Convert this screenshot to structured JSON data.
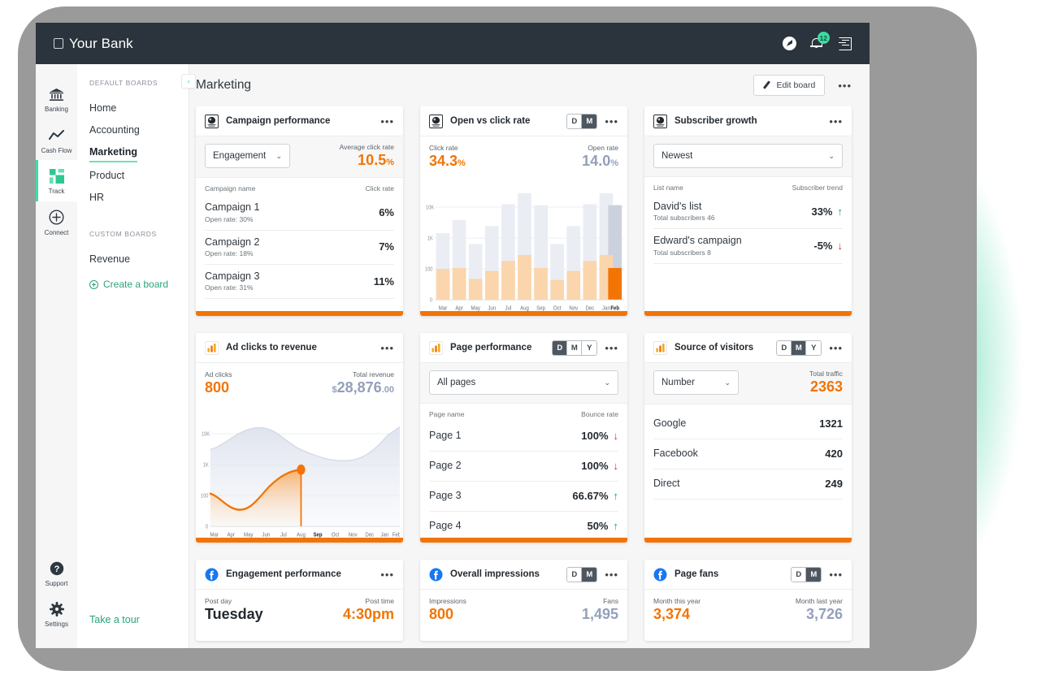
{
  "brand": {
    "name": "Your Bank"
  },
  "topbar": {
    "icons": [
      "compass-icon",
      "bell-icon",
      "logout-icon"
    ],
    "notification_count": "12"
  },
  "rail": {
    "items": [
      {
        "label": "Banking",
        "icon": "bank-icon",
        "active": false
      },
      {
        "label": "Cash Flow",
        "icon": "trend-line-icon",
        "active": false
      },
      {
        "label": "Track",
        "icon": "grid-squares-icon",
        "active": true
      },
      {
        "label": "Connect",
        "icon": "plus-circle-icon",
        "active": false
      }
    ],
    "bottom": [
      {
        "label": "Support",
        "icon": "help-circle-icon"
      },
      {
        "label": "Settings",
        "icon": "gear-icon"
      }
    ]
  },
  "boards": {
    "default_title": "DEFAULT BOARDS",
    "default_items": [
      "Home",
      "Accounting",
      "Marketing",
      "Product",
      "HR"
    ],
    "active_item": "Marketing",
    "custom_title": "CUSTOM BOARDS",
    "custom_items": [
      "Revenue"
    ],
    "create_label": "Create a board",
    "take_tour_label": "Take a tour",
    "collapse_icon": "chevron-left-icon"
  },
  "header": {
    "title": "Marketing",
    "edit_label": "Edit board",
    "more_icon": "ellipsis-icon"
  },
  "accent_color": "#f27405",
  "blue_color": "#93a0bb",
  "green_color": "#3ddca4",
  "cards": {
    "campaign_performance": {
      "title": "Campaign performance",
      "icon": "mailchimp-icon",
      "select": "Engagement",
      "stat_label": "Average click rate",
      "stat_value": "10.5",
      "stat_unit": "%",
      "col_left": "Campaign name",
      "col_right": "Click rate",
      "rows": [
        {
          "name": "Campaign 1",
          "sub": "Open rate: 30%",
          "value": "6%"
        },
        {
          "name": "Campaign 2",
          "sub": "Open rate: 18%",
          "value": "7%"
        },
        {
          "name": "Campaign 3",
          "sub": "Open rate: 31%",
          "value": "11%"
        }
      ]
    },
    "open_vs_click": {
      "title": "Open vs click rate",
      "icon": "mailchimp-icon",
      "segments": [
        "D",
        "M"
      ],
      "active_segment": "M",
      "left_label": "Click rate",
      "left_value": "34.3",
      "left_unit": "%",
      "right_label": "Open rate",
      "right_value": "14.0",
      "right_unit": "%"
    },
    "subscriber_growth": {
      "title": "Subscriber growth",
      "icon": "mailchimp-icon",
      "select": "Newest",
      "col_left": "List name",
      "col_right": "Subscriber trend",
      "rows": [
        {
          "name": "David's list",
          "sub": "Total subscribers 46",
          "value": "33%",
          "trend": "up"
        },
        {
          "name": "Edward's campaign",
          "sub": "Total subscribers 8",
          "value": "-5%",
          "trend": "down"
        }
      ]
    },
    "ad_clicks": {
      "title": "Ad clicks to revenue",
      "icon": "google-analytics-icon",
      "left_label": "Ad clicks",
      "left_value": "800",
      "right_label": "Total revenue",
      "right_currency": "$",
      "right_value": "28,876",
      "right_cents": ".00"
    },
    "page_performance": {
      "title": "Page performance",
      "icon": "google-analytics-icon",
      "segments": [
        "D",
        "M",
        "Y"
      ],
      "active_segment": "D",
      "select": "All pages",
      "col_left": "Page name",
      "col_right": "Bounce rate",
      "rows": [
        {
          "name": "Page 1",
          "value": "100%",
          "trend": "down"
        },
        {
          "name": "Page 2",
          "value": "100%",
          "trend": "down"
        },
        {
          "name": "Page 3",
          "value": "66.67%",
          "trend": "up"
        },
        {
          "name": "Page 4",
          "value": "50%",
          "trend": "up"
        }
      ]
    },
    "source_of_visitors": {
      "title": "Source of visitors",
      "icon": "google-analytics-icon",
      "segments": [
        "D",
        "M",
        "Y"
      ],
      "active_segment": "M",
      "select": "Number",
      "stat_label": "Total traffic",
      "stat_value": "2363",
      "rows": [
        {
          "name": "Google",
          "value": "1321"
        },
        {
          "name": "Facebook",
          "value": "420"
        },
        {
          "name": "Direct",
          "value": "249"
        }
      ]
    },
    "engagement_performance": {
      "title": "Engagement performance",
      "icon": "facebook-icon",
      "left_label": "Post day",
      "left_value": "Tuesday",
      "right_label": "Post time",
      "right_value": "4:30pm"
    },
    "overall_impressions": {
      "title": "Overall impressions",
      "icon": "facebook-icon",
      "segments": [
        "D",
        "M"
      ],
      "active_segment": "M",
      "left_label": "Impressions",
      "left_value": "800",
      "right_label": "Fans",
      "right_value": "1,495"
    },
    "page_fans": {
      "title": "Page fans",
      "icon": "facebook-icon",
      "segments": [
        "D",
        "M"
      ],
      "active_segment": "M",
      "left_label": "Month this year",
      "left_value": "3,374",
      "right_label": "Month last year",
      "right_value": "3,726"
    }
  },
  "chart_data": [
    {
      "type": "bar",
      "title": "Open vs click rate",
      "xlabel": "",
      "ylabel": "",
      "grid": true,
      "log_scale": true,
      "yticks": [
        "0",
        "100",
        "1K",
        "10K"
      ],
      "categories": [
        "Mar",
        "Apr",
        "May",
        "Jun",
        "Jul",
        "Aug",
        "Sep",
        "Oct",
        "Nov",
        "Dec",
        "Jan",
        "Feb"
      ],
      "highlight_category": "Feb",
      "series": [
        {
          "name": "Open rate",
          "color": "#e8ebf3",
          "values": [
            1600,
            4200,
            700,
            2600,
            11000,
            22000,
            10500,
            700,
            2600,
            11000,
            22000,
            10500
          ]
        },
        {
          "name": "Click rate",
          "color": "#fbd4ab",
          "values": [
            100,
            110,
            48,
            90,
            210,
            330,
            110,
            45,
            90,
            210,
            330,
            120
          ]
        }
      ],
      "highlight_color": "#f27405"
    },
    {
      "type": "area",
      "title": "Ad clicks to revenue",
      "xlabel": "",
      "ylabel": "",
      "grid": true,
      "log_scale": true,
      "yticks": [
        "0",
        "100",
        "1K",
        "10K"
      ],
      "categories": [
        "Mar",
        "Apr",
        "May",
        "Jun",
        "Jul",
        "Aug",
        "Sep",
        "Oct",
        "Nov",
        "Dec",
        "Jan",
        "Feb"
      ],
      "marker_category": "Sep",
      "series": [
        {
          "name": "Total revenue",
          "color": "#dfe4ef",
          "values": [
            2200,
            3600,
            6500,
            8000,
            7200,
            4000,
            2000,
            1500,
            1400,
            1700,
            4000,
            11000
          ]
        },
        {
          "name": "Ad clicks",
          "color": "#f27405",
          "values": [
            120,
            70,
            55,
            80,
            200,
            420,
            520,
            null,
            null,
            null,
            null,
            null
          ]
        }
      ]
    }
  ]
}
